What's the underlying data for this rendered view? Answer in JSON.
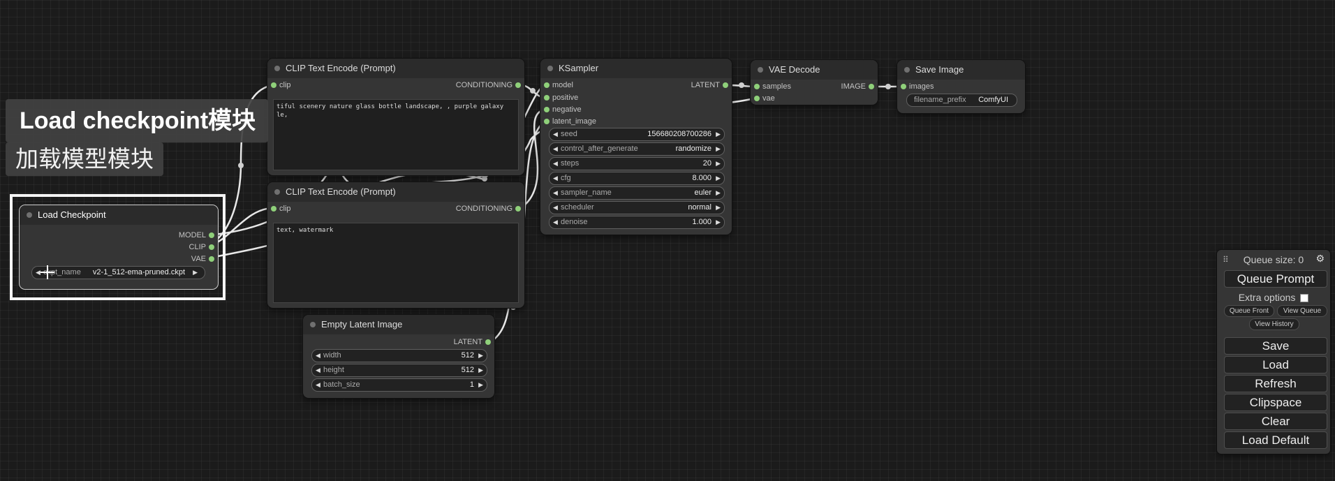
{
  "nodes": {
    "clip_top": {
      "title": "CLIP Text Encode (Prompt)",
      "input": "clip",
      "output": "CONDITIONING",
      "text": "tiful scenery nature glass bottle landscape, , purple galaxy\nle,"
    },
    "clip_bottom": {
      "title": "CLIP Text Encode (Prompt)",
      "input": "clip",
      "output": "CONDITIONING",
      "text": "text, watermark"
    },
    "ksampler": {
      "title": "KSampler",
      "inputs": [
        "model",
        "positive",
        "negative",
        "latent_image"
      ],
      "output": "LATENT",
      "widgets": [
        {
          "label": "seed",
          "value": "156680208700286"
        },
        {
          "label": "control_after_generate",
          "value": "randomize"
        },
        {
          "label": "steps",
          "value": "20"
        },
        {
          "label": "cfg",
          "value": "8.000"
        },
        {
          "label": "sampler_name",
          "value": "euler"
        },
        {
          "label": "scheduler",
          "value": "normal"
        },
        {
          "label": "denoise",
          "value": "1.000"
        }
      ]
    },
    "vae_decode": {
      "title": "VAE Decode",
      "inputs": [
        "samples",
        "vae"
      ],
      "output": "IMAGE"
    },
    "save_image": {
      "title": "Save Image",
      "input": "images",
      "widget": {
        "label": "filename_prefix",
        "value": "ComfyUI"
      }
    },
    "load_checkpoint": {
      "title": "Load Checkpoint",
      "outputs": [
        "MODEL",
        "CLIP",
        "VAE"
      ],
      "widget": {
        "label": "ckpt_name",
        "value": "v2-1_512-ema-pruned.ckpt"
      }
    },
    "empty_latent": {
      "title": "Empty Latent Image",
      "output": "LATENT",
      "widgets": [
        {
          "label": "width",
          "value": "512"
        },
        {
          "label": "height",
          "value": "512"
        },
        {
          "label": "batch_size",
          "value": "1"
        }
      ]
    }
  },
  "caption": {
    "title": "Load checkpoint模块",
    "subtitle": "加载模型模块"
  },
  "panel": {
    "queue_size": "Queue size: 0",
    "queue_prompt": "Queue Prompt",
    "extra_options": "Extra options",
    "queue_front": "Queue Front",
    "view_queue": "View Queue",
    "view_history": "View History",
    "save": "Save",
    "load": "Load",
    "refresh": "Refresh",
    "clipspace": "Clipspace",
    "clear": "Clear",
    "load_default": "Load Default"
  },
  "colors": {
    "slot_dot": "#8fd07a",
    "wire": "#e8e8e8",
    "node_bg": "#353535",
    "canvas_bg": "#1b1b1b"
  }
}
